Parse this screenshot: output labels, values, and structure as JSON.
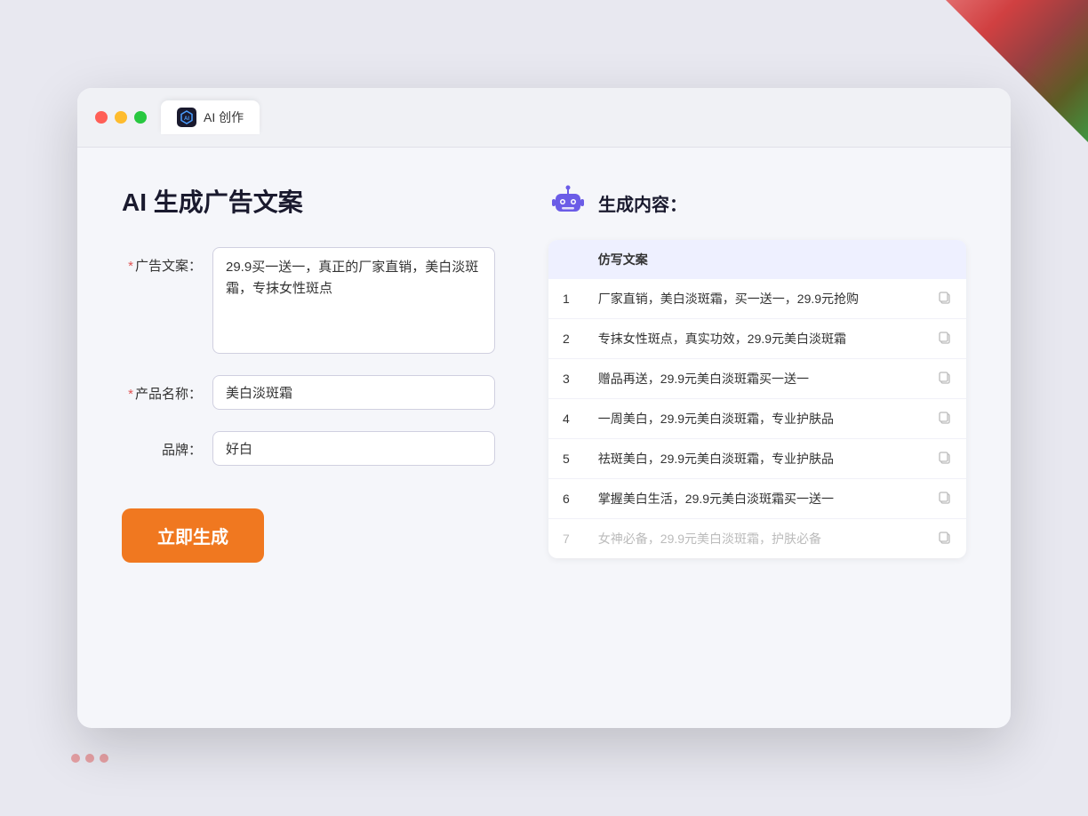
{
  "browser": {
    "tab_label": "AI 创作"
  },
  "page": {
    "title": "AI 生成广告文案",
    "result_title": "生成内容："
  },
  "form": {
    "ad_copy_label": "广告文案：",
    "ad_copy_required": true,
    "ad_copy_value": "29.9买一送一，真正的厂家直销，美白淡斑霜，专抹女性斑点",
    "product_name_label": "产品名称：",
    "product_name_required": true,
    "product_name_value": "美白淡斑霜",
    "brand_label": "品牌：",
    "brand_required": false,
    "brand_value": "好白",
    "generate_button": "立即生成"
  },
  "result": {
    "table_header": "仿写文案",
    "rows": [
      {
        "num": "1",
        "text": "厂家直销，美白淡斑霜，买一送一，29.9元抢购",
        "faded": false
      },
      {
        "num": "2",
        "text": "专抹女性斑点，真实功效，29.9元美白淡斑霜",
        "faded": false
      },
      {
        "num": "3",
        "text": "赠品再送，29.9元美白淡斑霜买一送一",
        "faded": false
      },
      {
        "num": "4",
        "text": "一周美白，29.9元美白淡斑霜，专业护肤品",
        "faded": false
      },
      {
        "num": "5",
        "text": "祛斑美白，29.9元美白淡斑霜，专业护肤品",
        "faded": false
      },
      {
        "num": "6",
        "text": "掌握美白生活，29.9元美白淡斑霜买一送一",
        "faded": false
      },
      {
        "num": "7",
        "text": "女神必备，29.9元美白淡斑霜，护肤必备",
        "faded": true
      }
    ]
  }
}
